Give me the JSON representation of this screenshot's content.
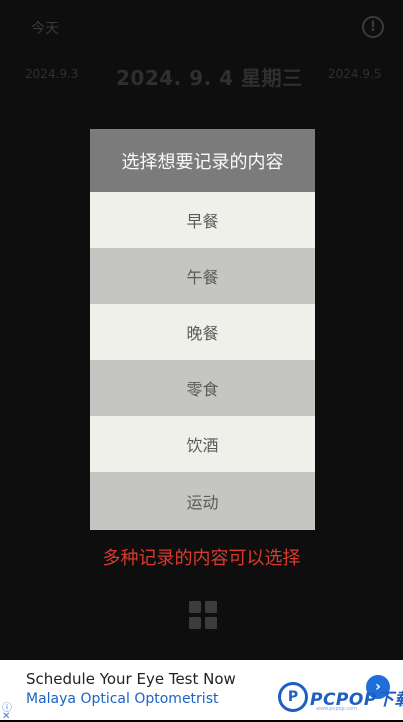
{
  "header": {
    "today_label": "今天",
    "alert_icon": "exclamation-circle-icon"
  },
  "dates": {
    "prev": "2024.9.3",
    "current": "2024. 9. 4 星期三",
    "next": "2024.9.5"
  },
  "dialog": {
    "title": "选择想要记录的内容",
    "options": [
      "早餐",
      "午餐",
      "晚餐",
      "零食",
      "饮酒",
      "运动"
    ]
  },
  "caption": "多种记录的内容可以选择",
  "bottom_icon": "grid-icon",
  "ad": {
    "info_icon": "ⓘ",
    "close_icon": "✕",
    "title": "Schedule Your Eye Test Now",
    "subtitle": "Malaya Optical Optometrist",
    "arrow_icon": "›"
  },
  "watermark": {
    "text": "PCPOP下载",
    "sub": "www.pcpop.com"
  },
  "colors": {
    "caption": "#d93a2e",
    "dialog_title_bg": "#7b7b7b",
    "option_light": "#f0f0eb",
    "option_dark": "#c5c5c1",
    "ad_accent": "#1e6fd9"
  }
}
